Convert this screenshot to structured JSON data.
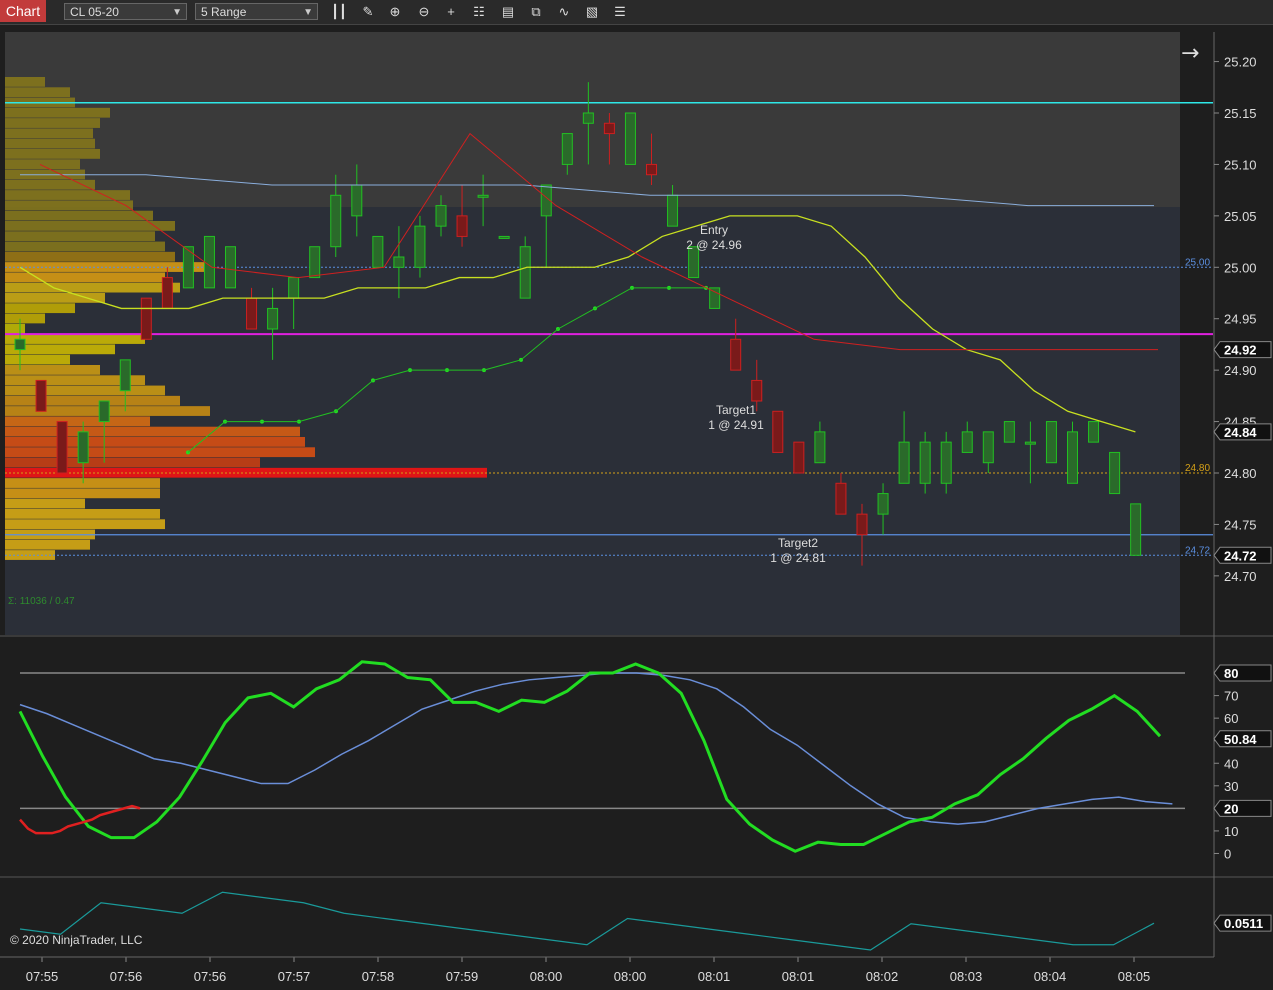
{
  "toolbar": {
    "chart_tab": "Chart",
    "instrument": "CL 05-20",
    "interval": "5 Range",
    "icons": [
      "bars-icon",
      "pencil-icon",
      "zoom-in-icon",
      "zoom-out-icon",
      "crosshair-icon",
      "properties-icon",
      "data-box-icon",
      "indicators-icon",
      "strategies-icon",
      "menu-icon"
    ]
  },
  "price_panel": {
    "ylim": [
      24.66,
      25.22
    ],
    "ticks": [
      "25.20",
      "25.15",
      "25.10",
      "25.05",
      "25.00",
      "24.95",
      "24.90",
      "24.85",
      "24.80",
      "24.75",
      "24.70"
    ],
    "tick_values": [
      25.2,
      25.15,
      25.1,
      25.05,
      25.0,
      24.95,
      24.9,
      24.85,
      24.8,
      24.75,
      24.7
    ],
    "badges": [
      {
        "label": "24.92",
        "value": 24.92
      },
      {
        "label": "24.84",
        "value": 24.84
      },
      {
        "label": "24.72",
        "value": 24.72
      }
    ],
    "inline_labels": [
      {
        "text": "25.00",
        "value": 25.0,
        "color": "#5b8fe0"
      },
      {
        "text": "24.80",
        "value": 24.8,
        "color": "#d4a017"
      },
      {
        "text": "24.72",
        "value": 24.72,
        "color": "#5b8fe0"
      }
    ],
    "status_text": "Σ: 11036 / 0.47",
    "annotations": [
      {
        "line1": "Entry",
        "line2": "2 @ 24.96",
        "bar": 24,
        "value": 24.96
      },
      {
        "line1": "Target1",
        "line2": "1 @ 24.91",
        "bar": 25,
        "value": 24.91
      },
      {
        "line1": "Target2",
        "line2": "1 @ 24.81",
        "bar": 28,
        "value": 24.81
      }
    ]
  },
  "chart_data": {
    "type": "candlestick",
    "candles": [
      {
        "o": 24.92,
        "h": 24.95,
        "l": 24.9,
        "c": 24.93
      },
      {
        "o": 24.89,
        "h": 24.89,
        "l": 24.86,
        "c": 24.86
      },
      {
        "o": 24.85,
        "h": 24.85,
        "l": 24.8,
        "c": 24.8
      },
      {
        "o": 24.81,
        "h": 24.85,
        "l": 24.79,
        "c": 24.84
      },
      {
        "o": 24.85,
        "h": 24.87,
        "l": 24.81,
        "c": 24.87
      },
      {
        "o": 24.88,
        "h": 24.91,
        "l": 24.86,
        "c": 24.91
      },
      {
        "o": 24.97,
        "h": 24.97,
        "l": 24.93,
        "c": 24.93
      },
      {
        "o": 24.99,
        "h": 25.0,
        "l": 24.96,
        "c": 24.96
      },
      {
        "o": 24.98,
        "h": 25.02,
        "l": 24.98,
        "c": 25.02
      },
      {
        "o": 24.98,
        "h": 25.03,
        "l": 24.98,
        "c": 25.03
      },
      {
        "o": 24.98,
        "h": 25.02,
        "l": 24.98,
        "c": 25.02
      },
      {
        "o": 24.97,
        "h": 24.98,
        "l": 24.94,
        "c": 24.94
      },
      {
        "o": 24.94,
        "h": 24.98,
        "l": 24.91,
        "c": 24.96
      },
      {
        "o": 24.97,
        "h": 24.99,
        "l": 24.94,
        "c": 24.99
      },
      {
        "o": 24.99,
        "h": 25.02,
        "l": 24.99,
        "c": 25.02
      },
      {
        "o": 25.02,
        "h": 25.09,
        "l": 25.01,
        "c": 25.07
      },
      {
        "o": 25.05,
        "h": 25.1,
        "l": 25.03,
        "c": 25.08
      },
      {
        "o": 25.0,
        "h": 25.03,
        "l": 25.0,
        "c": 25.03
      },
      {
        "o": 25.0,
        "h": 25.04,
        "l": 24.97,
        "c": 25.01
      },
      {
        "o": 25.0,
        "h": 25.05,
        "l": 24.99,
        "c": 25.04
      },
      {
        "o": 25.04,
        "h": 25.07,
        "l": 25.03,
        "c": 25.06
      },
      {
        "o": 25.05,
        "h": 25.08,
        "l": 25.02,
        "c": 25.03
      },
      {
        "o": 25.07,
        "h": 25.09,
        "l": 25.04,
        "c": 25.07
      },
      {
        "o": 25.03,
        "h": 25.03,
        "l": 25.03,
        "c": 25.03
      },
      {
        "o": 24.97,
        "h": 25.03,
        "l": 24.97,
        "c": 25.02
      },
      {
        "o": 25.05,
        "h": 25.08,
        "l": 25.0,
        "c": 25.08
      },
      {
        "o": 25.1,
        "h": 25.12,
        "l": 25.09,
        "c": 25.13
      },
      {
        "o": 25.14,
        "h": 25.18,
        "l": 25.1,
        "c": 25.15
      },
      {
        "o": 25.14,
        "h": 25.15,
        "l": 25.1,
        "c": 25.13
      },
      {
        "o": 25.1,
        "h": 25.15,
        "l": 25.1,
        "c": 25.15
      },
      {
        "o": 25.1,
        "h": 25.13,
        "l": 25.08,
        "c": 25.09
      },
      {
        "o": 25.04,
        "h": 25.08,
        "l": 25.04,
        "c": 25.07
      },
      {
        "o": 24.99,
        "h": 25.02,
        "l": 24.99,
        "c": 25.02
      },
      {
        "o": 24.96,
        "h": 24.98,
        "l": 24.96,
        "c": 24.98
      },
      {
        "o": 24.93,
        "h": 24.95,
        "l": 24.9,
        "c": 24.9
      },
      {
        "o": 24.89,
        "h": 24.91,
        "l": 24.86,
        "c": 24.87
      },
      {
        "o": 24.86,
        "h": 24.86,
        "l": 24.82,
        "c": 24.82
      },
      {
        "o": 24.83,
        "h": 24.83,
        "l": 24.8,
        "c": 24.8
      },
      {
        "o": 24.81,
        "h": 24.85,
        "l": 24.81,
        "c": 24.84
      },
      {
        "o": 24.79,
        "h": 24.8,
        "l": 24.76,
        "c": 24.76
      },
      {
        "o": 24.76,
        "h": 24.77,
        "l": 24.71,
        "c": 24.74
      },
      {
        "o": 24.76,
        "h": 24.79,
        "l": 24.74,
        "c": 24.78
      },
      {
        "o": 24.79,
        "h": 24.86,
        "l": 24.79,
        "c": 24.83
      },
      {
        "o": 24.79,
        "h": 24.84,
        "l": 24.78,
        "c": 24.83
      },
      {
        "o": 24.79,
        "h": 24.84,
        "l": 24.78,
        "c": 24.83
      },
      {
        "o": 24.82,
        "h": 24.85,
        "l": 24.82,
        "c": 24.84
      },
      {
        "o": 24.81,
        "h": 24.84,
        "l": 24.8,
        "c": 24.84
      },
      {
        "o": 24.83,
        "h": 24.85,
        "l": 24.83,
        "c": 24.85
      },
      {
        "o": 24.83,
        "h": 24.85,
        "l": 24.79,
        "c": 24.83
      },
      {
        "o": 24.81,
        "h": 24.85,
        "l": 24.81,
        "c": 24.85
      },
      {
        "o": 24.79,
        "h": 24.85,
        "l": 24.79,
        "c": 24.84
      },
      {
        "o": 24.83,
        "h": 24.85,
        "l": 24.83,
        "c": 24.85
      },
      {
        "o": 24.78,
        "h": 24.82,
        "l": 24.78,
        "c": 24.82
      },
      {
        "o": 24.72,
        "h": 24.77,
        "l": 24.72,
        "c": 24.77
      }
    ],
    "ema_yellow": [
      25.0,
      24.98,
      24.97,
      24.96,
      24.96,
      24.96,
      24.97,
      24.97,
      24.97,
      24.97,
      24.98,
      24.98,
      24.98,
      24.99,
      24.99,
      25.0,
      25.0,
      25.0,
      25.01,
      25.03,
      25.04,
      25.05,
      25.05,
      25.05,
      25.04,
      25.01,
      24.97,
      24.94,
      24.92,
      24.91,
      24.88,
      24.86,
      24.85,
      24.84
    ],
    "ma_lightblue": [
      25.09,
      25.09,
      25.08,
      25.08,
      25.08,
      25.07,
      25.07,
      25.07,
      25.06,
      25.06
    ],
    "trail_green": [
      24.82,
      24.85,
      24.85,
      24.85,
      24.86,
      24.89,
      24.9,
      24.9,
      24.9,
      24.91,
      24.94,
      24.96,
      24.98,
      24.98,
      24.98
    ],
    "trail_red": [
      25.1,
      25.06,
      25.0,
      24.99,
      25.0,
      25.13,
      25.06,
      25.01,
      24.97,
      24.93,
      24.92,
      24.92,
      24.92,
      24.92
    ]
  },
  "stoch_panel": {
    "ylim": [
      -6,
      88
    ],
    "ticks": [
      "80",
      "70",
      "60",
      "50",
      "40",
      "30",
      "20",
      "10",
      "0"
    ],
    "tick_values": [
      80,
      70,
      60,
      50,
      40,
      30,
      20,
      10,
      0
    ],
    "badges": [
      {
        "label": "80",
        "value": 80
      },
      {
        "label": "50.84",
        "value": 50.84
      },
      {
        "label": "20",
        "value": 20
      }
    ],
    "k_line": [
      63,
      43,
      25,
      12,
      7,
      7,
      14,
      25,
      41,
      58,
      69,
      71,
      65,
      73,
      77,
      85,
      84,
      78,
      77,
      67,
      67,
      63,
      68,
      67,
      72,
      80,
      80,
      84,
      80,
      71,
      50,
      24,
      13,
      6,
      1,
      5,
      4,
      4,
      9,
      14,
      16,
      22,
      26,
      35,
      42,
      51,
      59,
      64,
      70,
      63,
      52
    ],
    "d_line": [
      66,
      62,
      57,
      52,
      47,
      42,
      40,
      37,
      34,
      31,
      31,
      37,
      44,
      50,
      57,
      64,
      68,
      72,
      75,
      77,
      78,
      79,
      80,
      80,
      79,
      77,
      73,
      65,
      55,
      48,
      39,
      30,
      22,
      16,
      14,
      13,
      14,
      17,
      20,
      22,
      24,
      25,
      23,
      22
    ],
    "ma_line": [
      15,
      11,
      9,
      9,
      9,
      10,
      12,
      13,
      14,
      15,
      17,
      18,
      19,
      20,
      21,
      20
    ]
  },
  "bottom_panel": {
    "badge": {
      "label": "0.0511",
      "value": 0.0511
    },
    "line": [
      0.04,
      0.03,
      0.09,
      0.08,
      0.07,
      0.11,
      0.1,
      0.09,
      0.07,
      0.06,
      0.05,
      0.04,
      0.03,
      0.02,
      0.01,
      0.06,
      0.05,
      0.04,
      0.03,
      0.02,
      0.01,
      0.0,
      0.05,
      0.04,
      0.03,
      0.02,
      0.01,
      0.01,
      0.0511
    ]
  },
  "x_axis": {
    "labels": [
      "07:55",
      "07:56",
      "07:56",
      "07:57",
      "07:58",
      "07:59",
      "08:00",
      "08:00",
      "08:01",
      "08:01",
      "08:02",
      "08:03",
      "08:04",
      "08:05"
    ]
  },
  "copyright": "© 2020 NinjaTrader, LLC"
}
